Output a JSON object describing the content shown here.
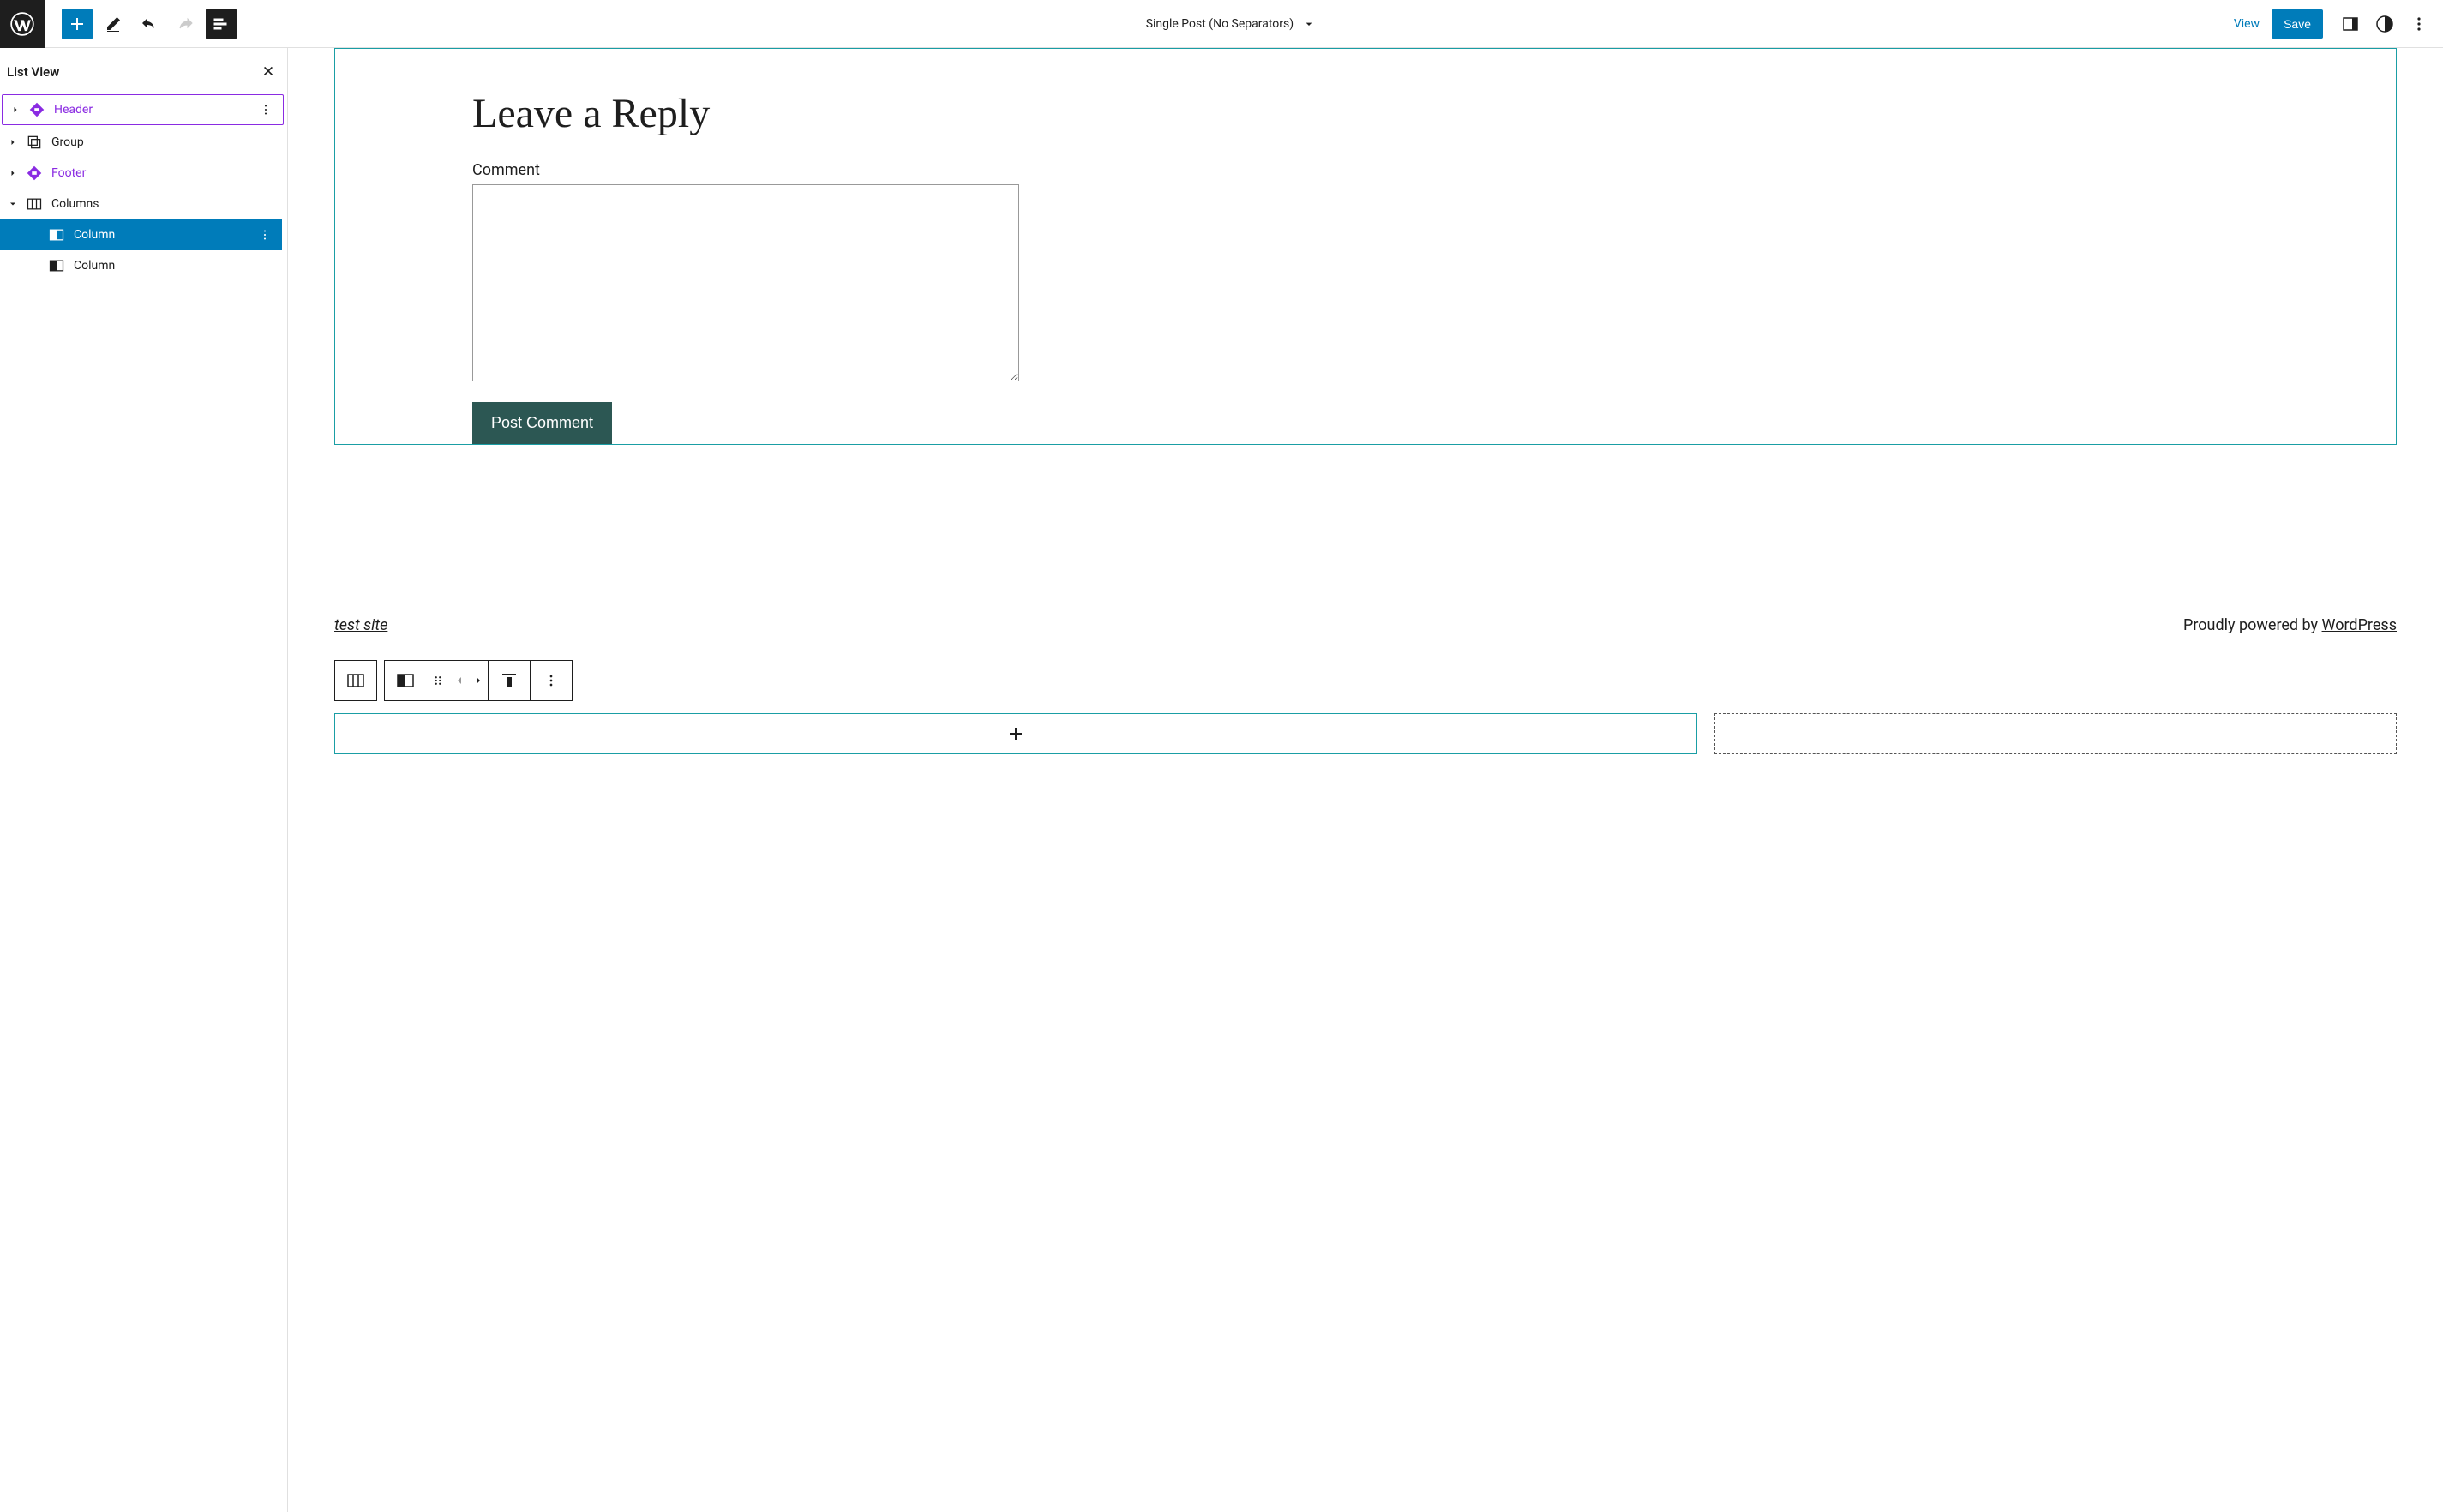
{
  "topbar": {
    "template_title": "Single Post (No Separators)",
    "view_label": "View",
    "save_label": "Save"
  },
  "sidebar": {
    "title": "List View",
    "tree": [
      {
        "label": "Header",
        "icon": "header-icon",
        "purple": true,
        "outlined": true,
        "expandable": true
      },
      {
        "label": "Group",
        "icon": "group-icon",
        "expandable": true
      },
      {
        "label": "Footer",
        "icon": "footer-icon",
        "purple": true,
        "expandable": true
      },
      {
        "label": "Columns",
        "icon": "columns-icon",
        "expanded": true,
        "children": [
          {
            "label": "Column",
            "icon": "column-icon",
            "selected": true
          },
          {
            "label": "Column",
            "icon": "column-icon"
          }
        ]
      }
    ]
  },
  "canvas": {
    "reply_heading": "Leave a Reply",
    "comment_label": "Comment",
    "post_comment_label": "Post Comment",
    "site_title": "test site",
    "powered_prefix": "Proudly powered by ",
    "powered_link": "WordPress"
  },
  "colors": {
    "accent": "#007cba",
    "teal_border": "#1a9ea5",
    "purple": "#8a2be2",
    "dark_btn": "#2c5753"
  }
}
